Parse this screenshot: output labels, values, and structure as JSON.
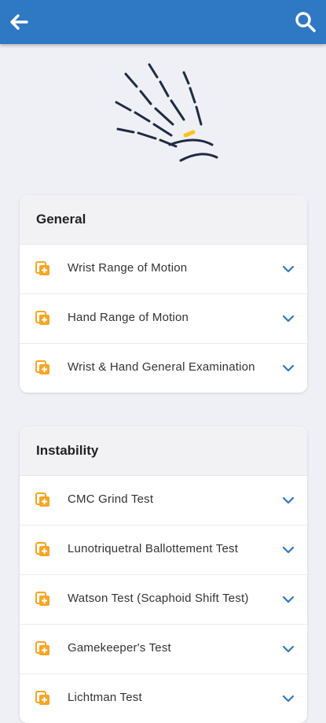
{
  "appbar": {
    "back_icon": "arrow-left-icon",
    "search_icon": "search-icon",
    "color": "#2f78c4"
  },
  "hero": {
    "icon": "hand-bones-icon"
  },
  "sections": [
    {
      "title": "General",
      "items": [
        {
          "label": "Wrist Range of Motion",
          "icon": "add-document-icon"
        },
        {
          "label": "Hand Range of Motion",
          "icon": "add-document-icon"
        },
        {
          "label": "Wrist & Hand General Examination",
          "icon": "add-document-icon"
        }
      ]
    },
    {
      "title": "Instability",
      "items": [
        {
          "label": "CMC Grind Test",
          "icon": "add-document-icon"
        },
        {
          "label": "Lunotriquetral Ballottement Test",
          "icon": "add-document-icon"
        },
        {
          "label": "Watson Test (Scaphoid Shift Test)",
          "icon": "add-document-icon"
        },
        {
          "label": "Gamekeeper's Test",
          "icon": "add-document-icon"
        },
        {
          "label": "Lichtman Test",
          "icon": "add-document-icon"
        }
      ]
    }
  ],
  "colors": {
    "accent": "#2f78c4",
    "icon_orange": "#f6a623",
    "background": "#eef0f5"
  }
}
